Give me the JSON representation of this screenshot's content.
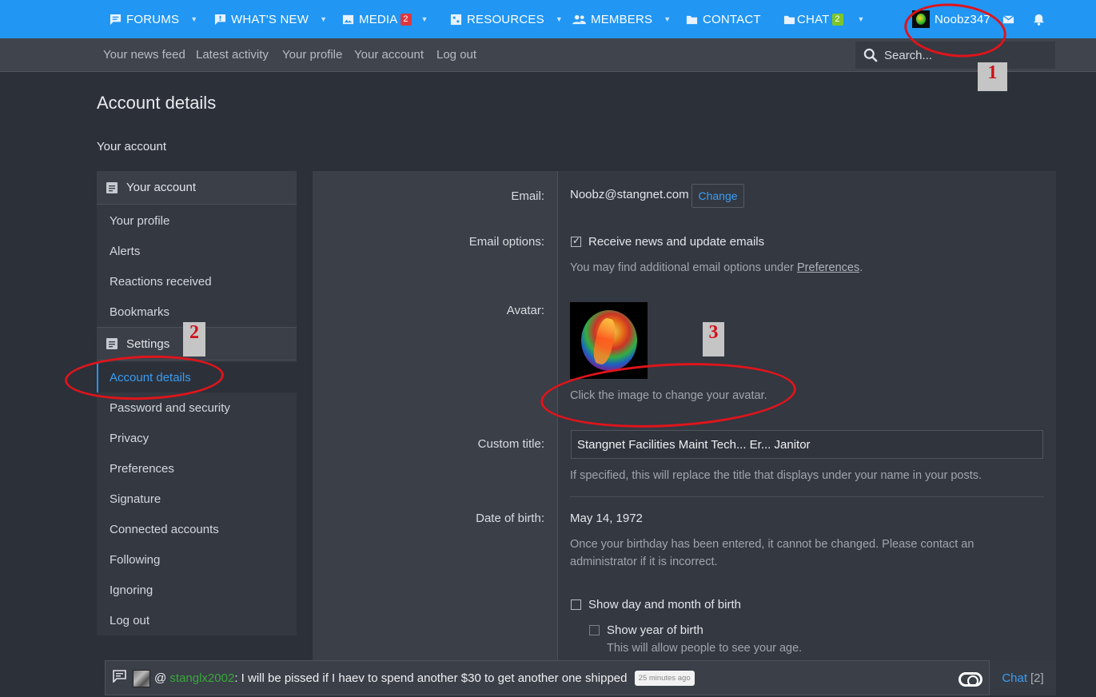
{
  "topnav": {
    "items": [
      {
        "label": "FORUMS",
        "icon": "forums-icon"
      },
      {
        "label": "WHAT'S NEW",
        "icon": "whats-new-icon"
      },
      {
        "label": "MEDIA",
        "icon": "media-icon",
        "badge": "2"
      },
      {
        "label": "RESOURCES",
        "icon": "resources-icon"
      },
      {
        "label": "MEMBERS",
        "icon": "members-icon"
      },
      {
        "label": "CONTACT",
        "icon": "folder-icon"
      },
      {
        "label": "CHAT",
        "icon": "chat-folder-icon",
        "badge": "2"
      }
    ],
    "username": "Noobz347"
  },
  "subnav": {
    "links": [
      "Your news feed",
      "Latest activity",
      "Your profile",
      "Your account",
      "Log out"
    ],
    "search_placeholder": "Search..."
  },
  "page": {
    "title": "Account details",
    "breadcrumb": "Your account"
  },
  "sidebar": {
    "section1": "Your account",
    "items1": [
      "Your profile",
      "Alerts",
      "Reactions received",
      "Bookmarks"
    ],
    "section2": "Settings",
    "items2": [
      "Account details",
      "Password and security",
      "Privacy",
      "Preferences",
      "Signature",
      "Connected accounts",
      "Following",
      "Ignoring",
      "Log out"
    ],
    "active": "Account details"
  },
  "form": {
    "email_label": "Email:",
    "email_value": "Noobz@stangnet.com",
    "change_label": "Change",
    "email_options_label": "Email options:",
    "receive_news_label": "Receive news and update emails",
    "receive_news_checked": true,
    "email_hint_prefix": "You may find additional email options under ",
    "email_hint_link": "Preferences",
    "email_hint_suffix": ".",
    "avatar_label": "Avatar:",
    "avatar_hint": "Click the image to change your avatar.",
    "custom_title_label": "Custom title:",
    "custom_title_value": "Stangnet Facilities Maint Tech... Er... Janitor",
    "custom_title_hint": "If specified, this will replace the title that displays under your name in your posts.",
    "dob_label": "Date of birth:",
    "dob_value": "May 14, 1972",
    "dob_hint_line1": "Once your birthday has been entered, it cannot be changed. Please contact an",
    "dob_hint_line2": "administrator if it is incorrect.",
    "show_day_month_label": "Show day and month of birth",
    "show_year_label": "Show year of birth",
    "show_year_hint": "This will allow people to see your age."
  },
  "annotations": [
    "1",
    "2",
    "3"
  ],
  "chat": {
    "at": "@",
    "username": "stanglx2002",
    "message": ": I will be pissed if I haev to spend another $30 to get another one shipped",
    "time": "25 minutes ago",
    "tab_label": "Chat",
    "tab_count": "[2]"
  },
  "colors": {
    "accent": "#2196f3",
    "background": "#2b3039",
    "annotation_red": "#e0141b",
    "chat_username": "#3aa83a"
  }
}
